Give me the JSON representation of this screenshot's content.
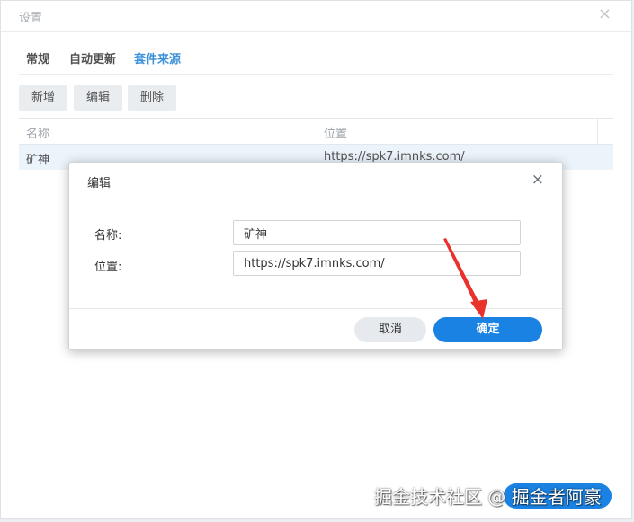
{
  "window": {
    "title": "设置",
    "close_icon": "×"
  },
  "tabs": [
    {
      "label": "常规",
      "active": false
    },
    {
      "label": "自动更新",
      "active": false
    },
    {
      "label": "套件来源",
      "active": true
    }
  ],
  "toolbar": {
    "add_label": "新增",
    "edit_label": "编辑",
    "delete_label": "删除"
  },
  "table": {
    "columns": [
      "名称",
      "位置"
    ],
    "rows": [
      {
        "name": "矿神",
        "location": "https://spk7.imnks.com/"
      }
    ]
  },
  "dialog": {
    "title": "编辑",
    "close_icon": "×",
    "name_label": "名称:",
    "name_value": "矿神",
    "location_label": "位置:",
    "location_value": "https://spk7.imnks.com/",
    "cancel_label": "取消",
    "ok_label": "确定"
  },
  "watermark": "掘金技术社区 @ 掘金者阿豪",
  "colors": {
    "accent": "#1a82e2",
    "arrow": "#e8322b",
    "row_highlight": "#e8f1fb"
  }
}
